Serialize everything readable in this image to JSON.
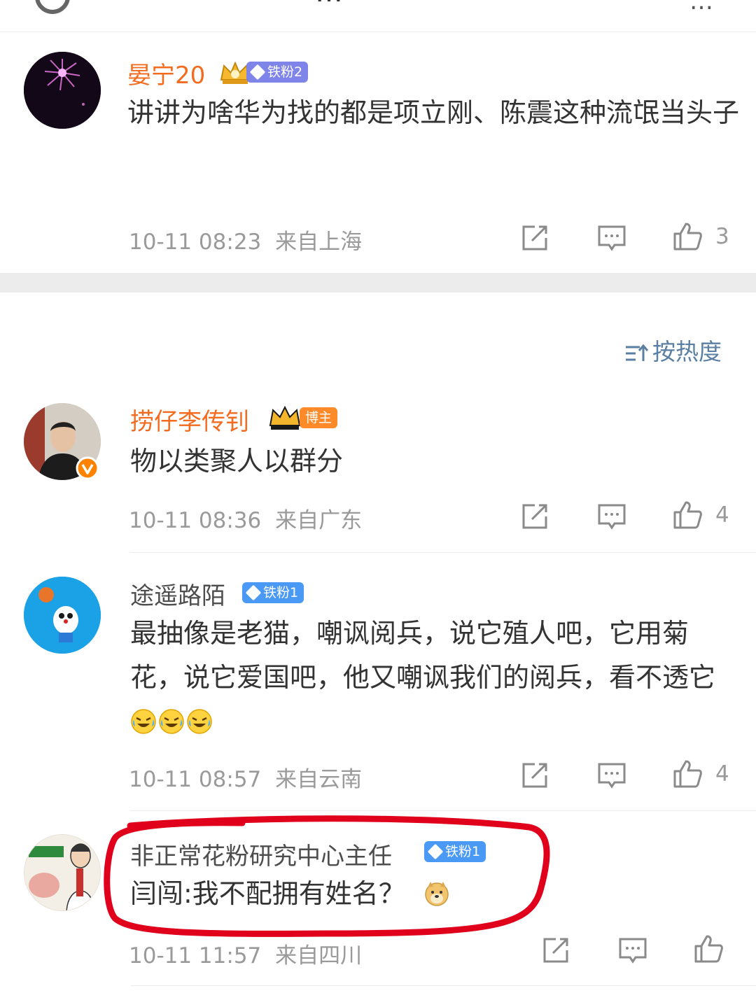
{
  "header": {
    "title": "…",
    "more": "…"
  },
  "comments": [
    {
      "name": "晏宁20",
      "badge": "铁粉2",
      "text": "讲讲为啥华为找的都是项立刚、陈震这种流氓当头子",
      "time": "10-11 08:23",
      "location": "来自上海",
      "likes": "3"
    },
    {
      "name": "捞仔李传钊",
      "badge": "博主",
      "text": "物以类聚人以群分",
      "time": "10-11 08:36",
      "location": "来自广东",
      "likes": "4"
    },
    {
      "name": "途遥路陌",
      "badge": "铁粉1",
      "text": "最抽像是老猫，嘲讽阅兵，说它殖人吧，它用菊花，说它爱国吧，他又嘲讽我们的阅兵，看不透它",
      "time": "10-11 08:57",
      "location": "来自云南",
      "likes": "4"
    },
    {
      "name": "非正常花粉研究中心主任",
      "badge": "铁粉1",
      "text": "闫闯:我不配拥有姓名？",
      "time": "10-11 11:57",
      "location": "来自四川",
      "likes": ""
    }
  ],
  "sort": {
    "label": "按热度"
  },
  "colors": {
    "username_orange": "#f26b1f",
    "badge_blue": "#4a9af5",
    "badge_purple": "#7f84e8",
    "sort_blue": "#5a7fa3",
    "annotation_red": "#e0001b"
  },
  "icons": {
    "share": "share-icon",
    "comment": "comment-icon",
    "like": "thumbs-up-icon",
    "sort": "sort-icon",
    "laugh_cry": "laugh-cry-emoji-icon",
    "doge": "doge-emoji-icon"
  }
}
